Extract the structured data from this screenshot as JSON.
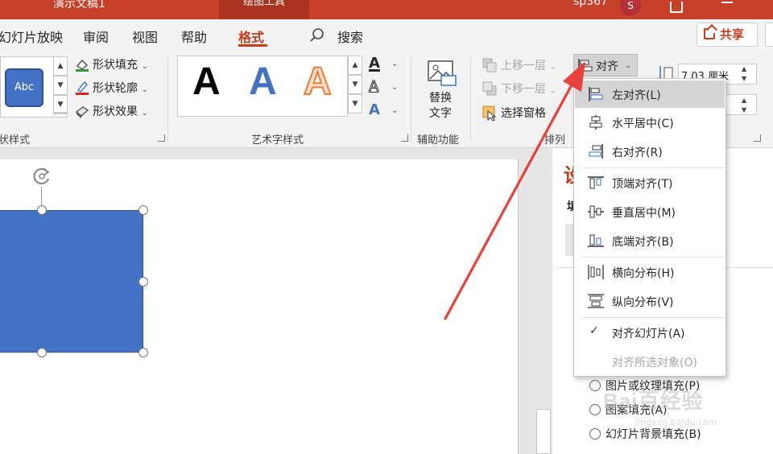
{
  "titlebar": {
    "doc_title": "演示文稿1",
    "context_tab": "绘图工具",
    "user_name": "sp367",
    "avatar_initial": "S",
    "bg_color": "#c6402a"
  },
  "tabs": {
    "slideshow": "幻灯片放映",
    "review": "审阅",
    "view": "视图",
    "help": "帮助",
    "format": "格式",
    "search": "搜索"
  },
  "share_label": "共享",
  "ribbon": {
    "shape_styles": {
      "label": "状样式",
      "sample_text": "Abc",
      "fill": "形状填充",
      "outline": "形状轮廓",
      "effect": "形状效果"
    },
    "wordart": {
      "label": "艺术字样式",
      "sample": "A"
    },
    "accessibility": {
      "label": "辅助功能",
      "alt_text_line1": "替换",
      "alt_text_line2": "文字"
    },
    "arrange": {
      "label": "排列",
      "bring_forward": "上移一层",
      "send_backward": "下移一层",
      "selection_pane": "选择窗格",
      "align": "对齐"
    },
    "size": {
      "height_value": "7.03 厘米"
    }
  },
  "align_menu": {
    "items": [
      {
        "label": "左对齐(L)"
      },
      {
        "label": "水平居中(C)"
      },
      {
        "label": "右对齐(R)"
      },
      {
        "label": "顶端对齐(T)"
      },
      {
        "label": "垂直居中(M)"
      },
      {
        "label": "底端对齐(B)"
      },
      {
        "label": "横向分布(H)"
      },
      {
        "label": "纵向分布(V)"
      },
      {
        "label": "对齐幻灯片(A)"
      },
      {
        "label": "对齐所选对象(O)"
      }
    ],
    "checked_mark": "✓"
  },
  "pane": {
    "title": "设",
    "sub": "填",
    "options": [
      {
        "label": "图片或纹理填充(P)"
      },
      {
        "label": "图案填充(A)"
      },
      {
        "label": "幻灯片背景填充(B)"
      }
    ]
  },
  "watermark": {
    "brand": "Bai百经验",
    "url": "jingyan.baidu.com"
  },
  "colors": {
    "accent": "#c43e1c",
    "shape_fill": "#4472c4",
    "arrow": "#e8403a"
  }
}
